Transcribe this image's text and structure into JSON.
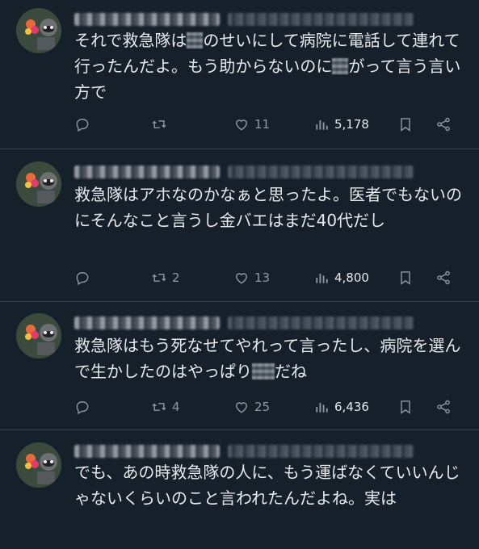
{
  "tweets": [
    {
      "text_parts": [
        "それで救急隊は",
        "",
        "のせいにして病院に電話して連れて行ったんだよ。もう助からないのに",
        "",
        "がって言う言い方で"
      ],
      "replies": "",
      "retweets": "",
      "likes": "11",
      "views": "5,178"
    },
    {
      "text_parts": [
        "救急隊はアホなのかなぁと思ったよ。医者でもないのにそんなこと言うし金バエはまだ40代だし"
      ],
      "replies": "",
      "retweets": "2",
      "likes": "13",
      "views": "4,800"
    },
    {
      "text_parts": [
        "救急隊はもう死なせてやれって言ったし、病院を選んで生かしたのはやっぱり",
        "",
        "だね"
      ],
      "replies": "",
      "retweets": "4",
      "likes": "25",
      "views": "6,436"
    },
    {
      "text_parts": [
        "でも、あの時救急隊の人に、もう運ばなくていいんじゃないくらいのこと言われたんだよね。実は"
      ]
    }
  ],
  "icons": {
    "reply": "reply-icon",
    "retweet": "retweet-icon",
    "like": "heart-icon",
    "views": "views-icon",
    "bookmark": "bookmark-icon",
    "share": "share-icon"
  },
  "colors": {
    "background": "#15202b",
    "text": "#e7e9ea",
    "muted": "#8b98a5",
    "divider": "#38444d"
  }
}
